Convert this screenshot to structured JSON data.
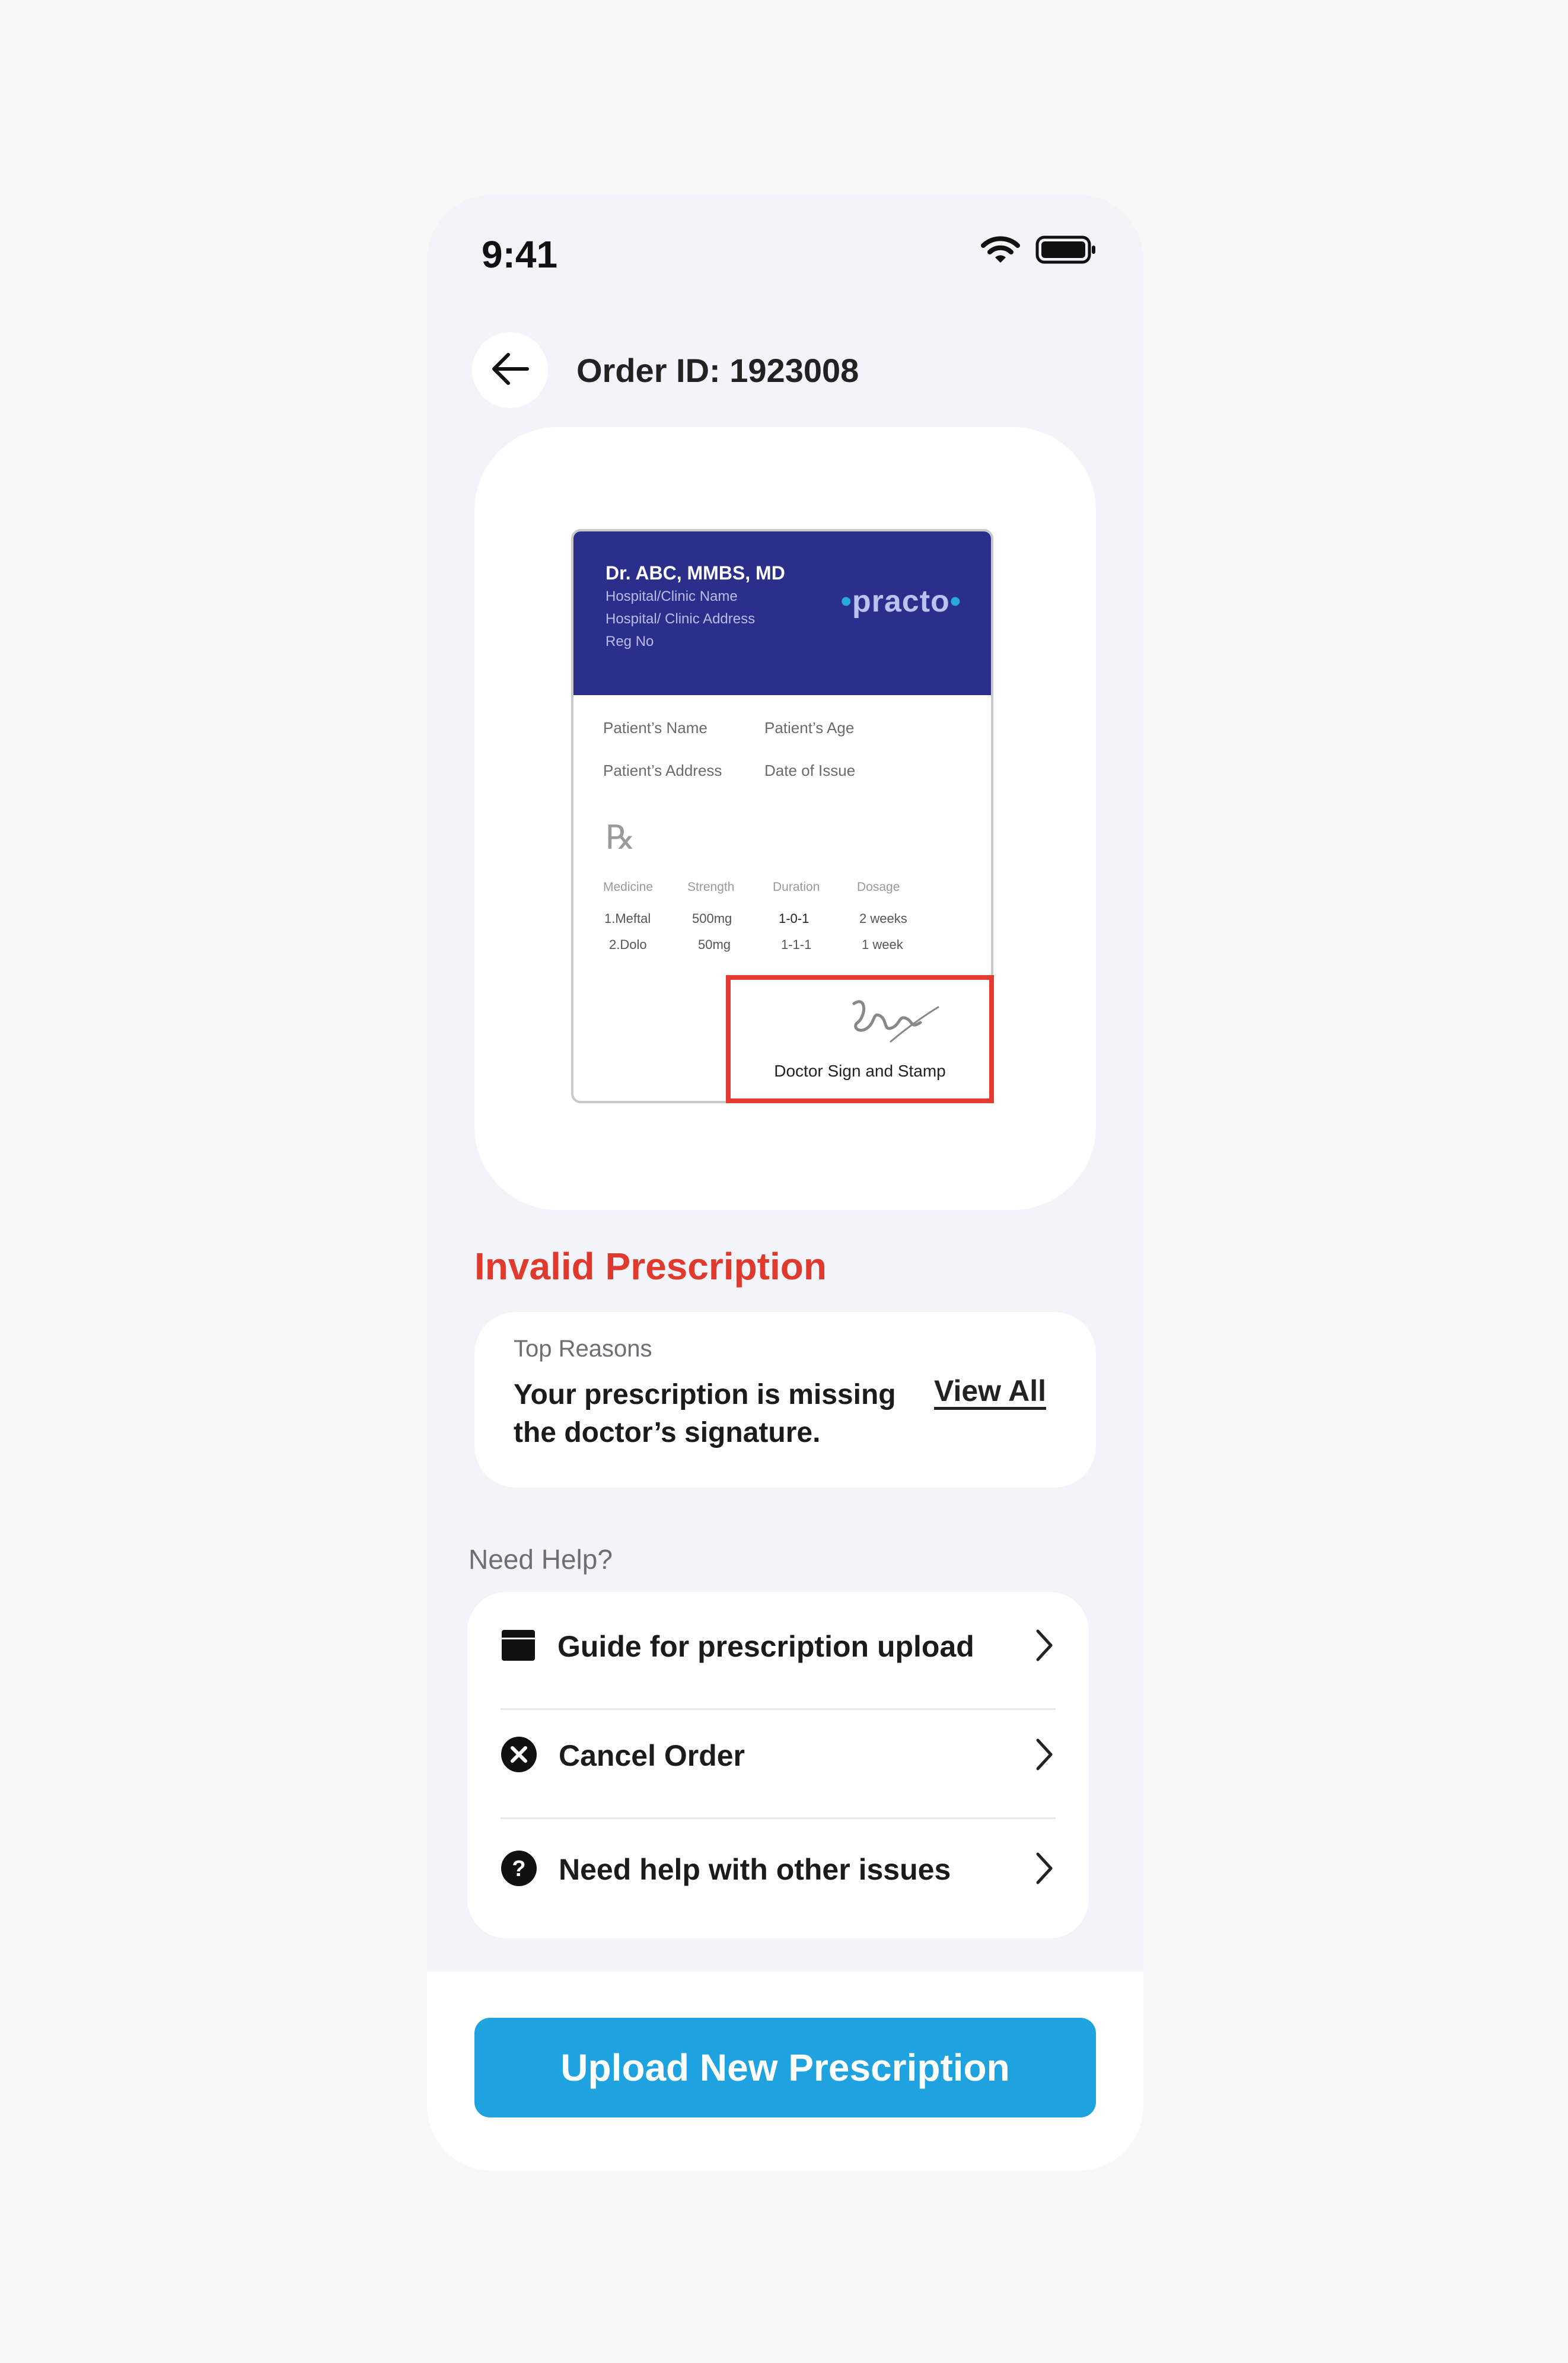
{
  "status_bar": {
    "time": "9:41",
    "icons": [
      "wifi-icon",
      "battery-icon"
    ]
  },
  "header": {
    "back_icon": "arrow-left-icon",
    "title": "Order ID: 1923008"
  },
  "prescription_preview": {
    "doctor": "Dr. ABC, MMBS, MD",
    "hospital_name": "Hospital/Clinic Name",
    "hospital_address": "Hospital/ Clinic Address",
    "reg_no": "Reg No",
    "logo": "practo",
    "patient_name": "Patient’s Name",
    "patient_age": "Patient’s Age",
    "patient_address": "Patient’s Address",
    "date_of_issue": "Date of Issue",
    "rx_symbol": "℞",
    "columns": [
      "Medicine",
      "Strength",
      "Duration",
      "Dosage"
    ],
    "rows": [
      [
        "1.Meftal",
        "500mg",
        "1-0-1",
        "2 weeks"
      ],
      [
        "2.Dolo",
        "50mg",
        "1-1-1",
        "1 week"
      ]
    ],
    "sign_label": "Doctor Sign and Stamp"
  },
  "status": {
    "title": "Invalid Prescription",
    "color": "#e03a2e"
  },
  "reasons": {
    "label": "Top Reasons",
    "text": "Your prescription is missing the doctor’s signature.",
    "view_all": "View All"
  },
  "help": {
    "label": "Need Help?",
    "items": [
      {
        "icon": "calendar-icon",
        "label": "Guide for prescription upload"
      },
      {
        "icon": "close-circle-icon",
        "label": "Cancel Order"
      },
      {
        "icon": "question-circle-icon",
        "label": "Need help with other issues"
      }
    ]
  },
  "footer": {
    "upload_label": "Upload New Prescription",
    "accent": "#1fa3e0"
  }
}
